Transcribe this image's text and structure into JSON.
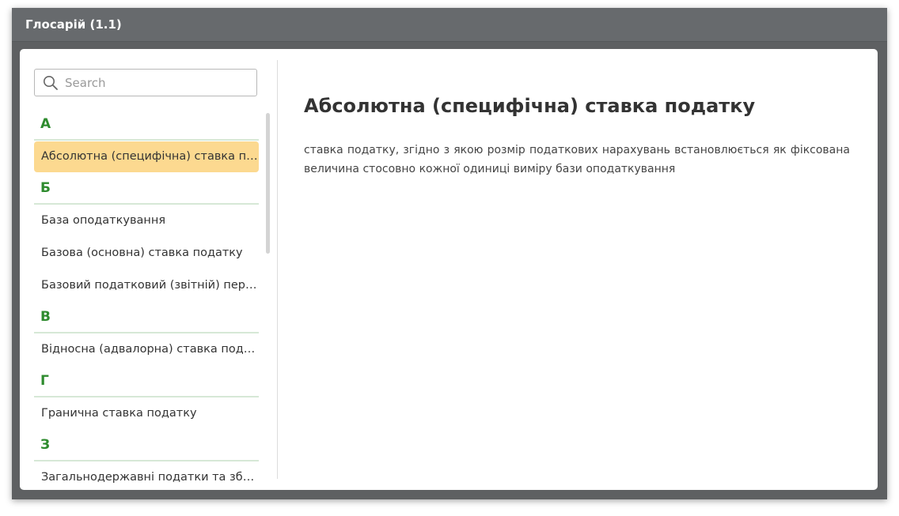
{
  "window": {
    "title": "Глосарій (1.1)"
  },
  "search": {
    "placeholder": "Search",
    "value": ""
  },
  "glossary": {
    "groups": [
      {
        "letter": "А",
        "items": [
          "Абсолютна (специфічна) ставка податку"
        ]
      },
      {
        "letter": "Б",
        "items": [
          "База оподаткування",
          "Базова (основна) ставка податку",
          "Базовий податковий (звітній) період"
        ]
      },
      {
        "letter": "В",
        "items": [
          "Відносна (адвалорна) ставка податку"
        ]
      },
      {
        "letter": "Г",
        "items": [
          "Гранична ставка податку"
        ]
      },
      {
        "letter": "З",
        "items": [
          "Загальнодержавні податки та збори"
        ]
      }
    ],
    "selected": "Абсолютна (специфічна) ставка податку"
  },
  "content": {
    "title": "Абсолютна (специфічна) ставка податку",
    "definition": "ставка податку, згідно з якою розмір податкових нарахувань встановлюється як фіксована величина стосовно кожної одиниці виміру бази оподаткування"
  },
  "colors": {
    "titlebar": "#676a6d",
    "letter": "#2e8b2e",
    "selected": "#fcd990"
  }
}
